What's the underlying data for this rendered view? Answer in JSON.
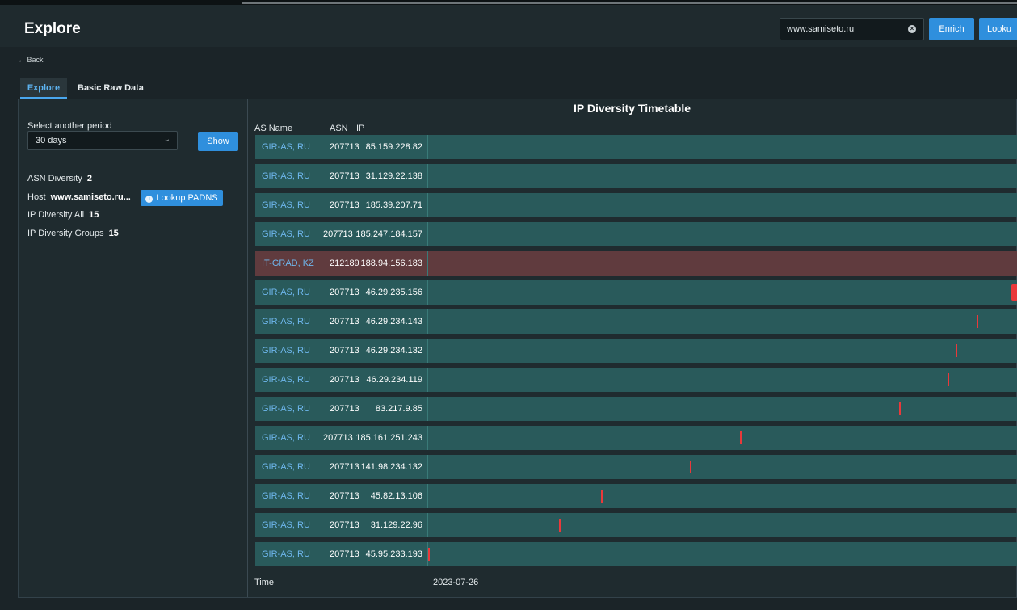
{
  "app": {
    "title": "Explore"
  },
  "search": {
    "value": "www.samiseto.ru"
  },
  "buttons": {
    "enrich": "Enrich",
    "lookup": "Looku",
    "show": "Show",
    "lookup_padns": "Lookup PADNS"
  },
  "nav": {
    "back": "← Back"
  },
  "tabs": [
    {
      "label": "Explore",
      "active": true
    },
    {
      "label": "Basic Raw Data",
      "active": false
    }
  ],
  "left": {
    "period_label": "Select another period",
    "period_value": "30 days",
    "asn_diversity_label": "ASN Diversity",
    "asn_diversity_value": "2",
    "host_label": "Host",
    "host_value": "www.samiseto.ru...",
    "ip_all_label": "IP Diversity All",
    "ip_all_value": "15",
    "ip_groups_label": "IP Diversity Groups",
    "ip_groups_value": "15"
  },
  "chart": {
    "title": "IP Diversity Timetable",
    "col_as_name": "AS Name",
    "col_asn": "ASN",
    "col_ip": "IP",
    "time_label": "Time",
    "date_label": "2023-07-26"
  },
  "rows": [
    {
      "as_name": "GIR-AS, RU",
      "asn": "207713",
      "ip": "85.159.228.82",
      "status": "normal",
      "mark_position": null
    },
    {
      "as_name": "GIR-AS, RU",
      "asn": "207713",
      "ip": "31.129.22.138",
      "status": "normal",
      "mark_position": null
    },
    {
      "as_name": "GIR-AS, RU",
      "asn": "207713",
      "ip": "185.39.207.71",
      "status": "normal",
      "mark_position": null
    },
    {
      "as_name": "GIR-AS, RU",
      "asn": "207713",
      "ip": "185.247.184.157",
      "status": "normal",
      "mark_position": null
    },
    {
      "as_name": "IT-GRAD, KZ",
      "asn": "212189",
      "ip": "188.94.156.183",
      "status": "alert",
      "mark_position": null
    },
    {
      "as_name": "GIR-AS, RU",
      "asn": "207713",
      "ip": "46.29.235.156",
      "status": "normal",
      "mark_position": 1.0
    },
    {
      "as_name": "GIR-AS, RU",
      "asn": "207713",
      "ip": "46.29.234.143",
      "status": "normal",
      "mark_position": 0.94
    },
    {
      "as_name": "GIR-AS, RU",
      "asn": "207713",
      "ip": "46.29.234.132",
      "status": "normal",
      "mark_position": 0.905
    },
    {
      "as_name": "GIR-AS, RU",
      "asn": "207713",
      "ip": "46.29.234.119",
      "status": "normal",
      "mark_position": 0.89
    },
    {
      "as_name": "GIR-AS, RU",
      "asn": "207713",
      "ip": "83.217.9.85",
      "status": "normal",
      "mark_position": 0.807
    },
    {
      "as_name": "GIR-AS, RU",
      "asn": "207713",
      "ip": "185.161.251.243",
      "status": "normal",
      "mark_position": 0.534
    },
    {
      "as_name": "GIR-AS, RU",
      "asn": "207713",
      "ip": "141.98.234.132",
      "status": "normal",
      "mark_position": 0.449
    },
    {
      "as_name": "GIR-AS, RU",
      "asn": "207713",
      "ip": "45.82.13.106",
      "status": "normal",
      "mark_position": 0.296
    },
    {
      "as_name": "GIR-AS, RU",
      "asn": "207713",
      "ip": "31.129.22.96",
      "status": "normal",
      "mark_position": 0.225
    },
    {
      "as_name": "GIR-AS, RU",
      "asn": "207713",
      "ip": "45.95.233.193",
      "status": "normal",
      "mark_position": 0.0
    }
  ]
}
